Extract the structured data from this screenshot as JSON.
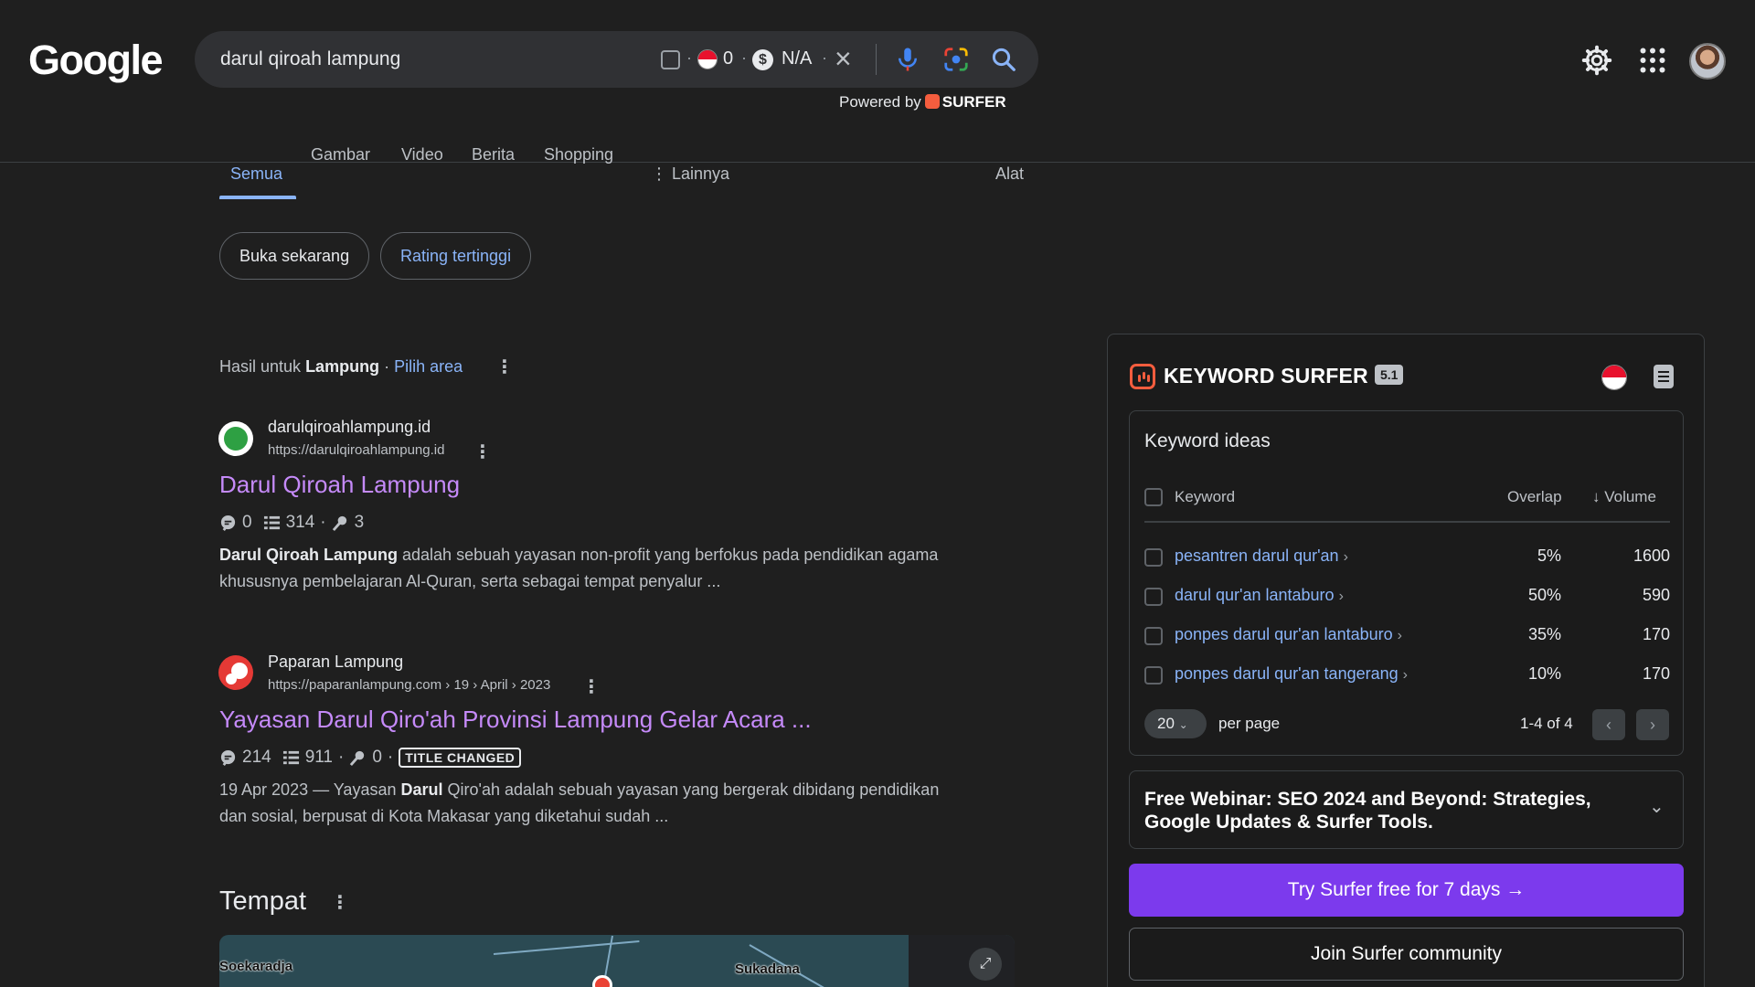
{
  "header": {
    "logo": "Google",
    "search_query": "darul qiroah lampung",
    "search_metric_1": "0",
    "search_metric_2": "N/A",
    "powered_by": "Powered by",
    "surfer_brand": "SURFER"
  },
  "tabs": {
    "active": "Semua",
    "items": [
      "Gambar",
      "Video",
      "Berita",
      "Shopping"
    ],
    "more": "Lainnya",
    "tools": "Alat"
  },
  "chips": [
    "Buka sekarang",
    "Rating tertinggi"
  ],
  "location": {
    "prefix": "Hasil untuk",
    "place": "Lampung",
    "separator": "·",
    "change": "Pilih area"
  },
  "results": [
    {
      "site": "darulqiroahlampung.id",
      "url": "https://darulqiroahlampung.id",
      "title": "Darul Qiroah Lampung",
      "m1": "0",
      "m2": "314",
      "m3": "3",
      "snippet_bold": "Darul Qiroah Lampung",
      "snippet_rest": " adalah sebuah yayasan non-profit yang berfokus pada pendidikan agama khususnya pembelajaran Al-Quran, serta sebagai tempat penyalur ..."
    },
    {
      "site": "Paparan Lampung",
      "url": "https://paparanlampung.com › 19 › April › 2023",
      "title": "Yayasan Darul Qiro'ah Provinsi Lampung Gelar Acara ...",
      "m1": "214",
      "m2": "911",
      "m3": "0",
      "badge": "TITLE CHANGED",
      "date": "19 Apr 2023 — Yayasan ",
      "snippet_bold": "Darul",
      "snippet_rest": " Qiro'ah adalah sebuah yayasan yang bergerak dibidang pendidikan dan sosial, berpusat di Kota Makasar yang diketahui sudah ..."
    }
  ],
  "places": {
    "heading": "Tempat",
    "map_labels": [
      "Soekaradja",
      "Sukadana"
    ]
  },
  "surfer_panel": {
    "title": "KEYWORD SURFER",
    "version": "5.1",
    "ideas_heading": "Keyword ideas",
    "col_keyword": "Keyword",
    "col_overlap": "Overlap",
    "col_volume": "↓ Volume",
    "rows": [
      {
        "keyword": "pesantren darul qur'an",
        "overlap": "5%",
        "volume": "1600"
      },
      {
        "keyword": "darul qur'an lantaburo",
        "overlap": "50%",
        "volume": "590"
      },
      {
        "keyword": "ponpes darul qur'an lantaburo",
        "overlap": "35%",
        "volume": "170"
      },
      {
        "keyword": "ponpes darul qur'an tangerang",
        "overlap": "10%",
        "volume": "170"
      }
    ],
    "per_page_value": "20",
    "per_page_label": "per page",
    "page_info": "1-4 of 4",
    "webinar": "Free Webinar: SEO 2024 and Beyond: Strategies, Google Updates & Surfer Tools.",
    "try_button": "Try Surfer free for 7 days →",
    "join_button": "Join Surfer community"
  },
  "colors": {
    "accent_link": "#8ab4f8",
    "visited_title": "#c58af9",
    "surfer_orange": "#f55d3e",
    "surfer_purple": "#7c3aed"
  }
}
